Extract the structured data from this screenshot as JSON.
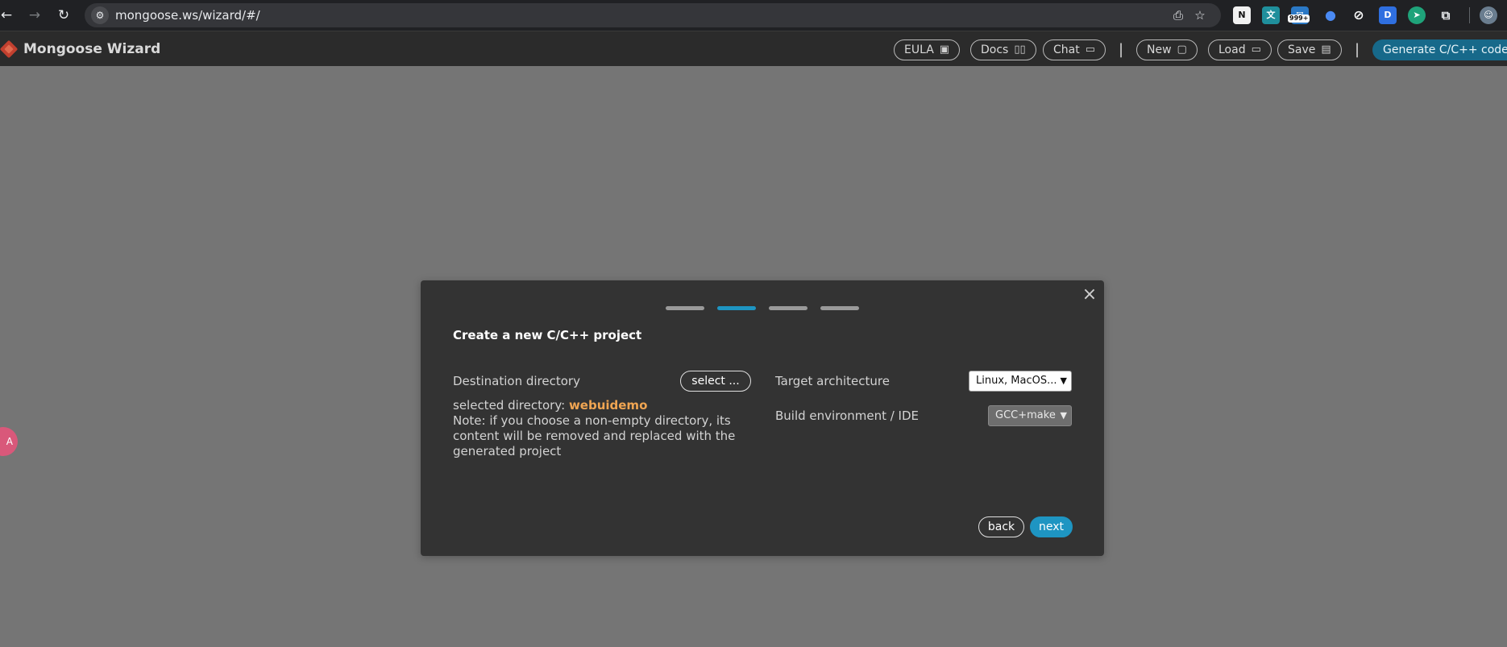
{
  "browser": {
    "url": "mongoose.ws/wizard/#/",
    "extension_badge": "999+",
    "extension_d_label": "D"
  },
  "header": {
    "title": "Mongoose Wizard",
    "buttons": {
      "eula": "EULA",
      "docs": "Docs",
      "chat": "Chat",
      "new": "New",
      "load": "Load",
      "save": "Save"
    },
    "separator": "|",
    "generate": "Generate C/C++ code"
  },
  "float_widget": {
    "label": "A"
  },
  "modal": {
    "title": "Create a new C/C++ project",
    "current_step": 2,
    "total_steps": 4,
    "destination": {
      "label": "Destination directory",
      "button": "select  ...",
      "selected_prefix": "selected directory:",
      "selected_value": "webuidemo",
      "note": "Note: if you choose a non-empty directory, its content will be removed and replaced with the generated project"
    },
    "target_arch": {
      "label": "Target architecture",
      "value": "Linux, MacOS..."
    },
    "build_env": {
      "label": "Build environment / IDE",
      "value": "GCC+make"
    },
    "back": "back",
    "next": "next"
  },
  "colors": {
    "accent": "#1e95c2",
    "highlight": "#f0a552",
    "backdrop": "#757575",
    "modal_bg": "#333333"
  }
}
